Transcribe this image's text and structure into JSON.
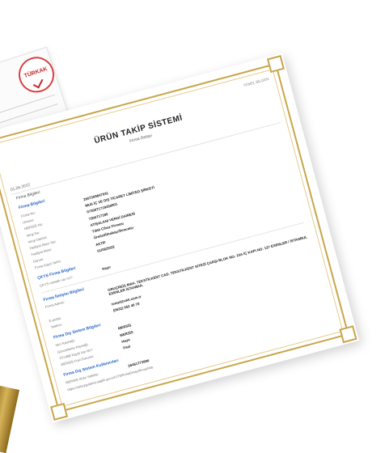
{
  "header": {
    "brand": "TEMEL BİLGEN"
  },
  "title": "ÜRÜN TAKİP SİSTEMİ",
  "subtitle": "Firma Detayı",
  "date": "01.06.2022",
  "page_head": "Firma Bilgileri",
  "company_section": {
    "title": "Firma Bilgileri",
    "rows": [
      {
        "label": "Firma No:",
        "value": "2667269847931"
      },
      {
        "label": "Unvanı:",
        "value": "MUS İÇ VE DIŞ TİCARET LİMİTED ŞİRKETİ"
      },
      {
        "label": "MERSİS No:",
        "value": "0730071718450001"
      },
      {
        "label": "Vergi No:",
        "value": "7300717185"
      },
      {
        "label": "Vergi Dairesi:",
        "value": "ATIŞALANI VERGİ DAİRESİ"
      },
      {
        "label": "Faaliyet Alanı Tipi:",
        "value": "Tıbbi Cihaz Firması"
      },
      {
        "label": "Faaliyet Alanı:",
        "value": "Üretici/İthalatçı/İhracatçı"
      },
      {
        "label": "Durum:",
        "value": "AKTİF"
      },
      {
        "label": "Firma Kayıt Tarihi:",
        "value": "01/06/2022"
      }
    ]
  },
  "cksys_section": {
    "title": "ÇKYS Firma Bilgileri",
    "rows": [
      {
        "label": "ÇKYS ruhsatlı var mı?:",
        "value": "Hayır"
      }
    ]
  },
  "contact_section": {
    "title": "Firma İletişim Bilgileri",
    "rows": [
      {
        "label": "Firma Adresi:",
        "value": "ORUÇREİS MAH. TEKSTİLKENT CAD. TEKSTİLKENT SİTESİ ÇARŞI BLOK NO: 10A İÇ KAPI NO: 127 ESENLER / İSTANBUL ESENLER İSTANBUL"
      },
      {
        "label": "E-posta:",
        "value": "temel@ukk.com.tr"
      },
      {
        "label": "Telefon:",
        "value": "(0532) 052 40 70"
      }
    ]
  },
  "external_section": {
    "title": "Firma Dış Sistem Bilgileri",
    "rows": [
      {
        "label": "Veri Kaynağı:",
        "value": "MERSİS"
      },
      {
        "label": "Güncelleme Kaynağı:",
        "value": "MERSİS"
      },
      {
        "label": "TİTUBB Kaydı Var Mı?:",
        "value": "Hayır"
      },
      {
        "label": "MERSİS Fuel Durumu:",
        "value": "Faal"
      }
    ]
  },
  "users_section": {
    "title": "Firma Dış Sistem Kullanıcıları",
    "rows": [
      {
        "label": "MERSİS İmza Yetkilisi:",
        "value": "26461773996"
      }
    ]
  },
  "footer_url": "https://utsuygulama.saglik.gov.tr/UTS/firmaDetay/firma/liste",
  "seal": {
    "text": "TÜRKAK"
  }
}
